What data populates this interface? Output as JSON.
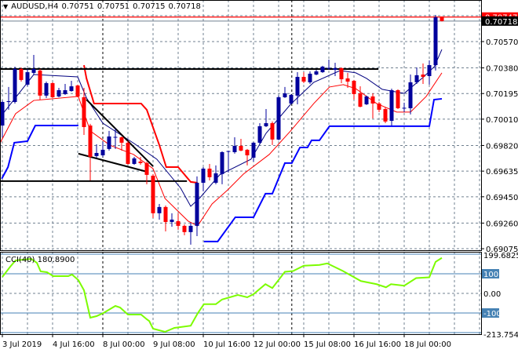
{
  "header": {
    "symbol": "AUDUSD,H4",
    "open": "0.70751",
    "high": "0.70751",
    "low": "0.70715",
    "close": "0.70718",
    "menu_icon": "triangle-down-icon"
  },
  "colors": {
    "bull": "#00009c",
    "bear": "#ff0000",
    "ma_fast": "#000080",
    "ma_slow": "#ff0000",
    "channel_upper": "#ff0000",
    "channel_lower": "#0000ff",
    "cci": "#7cfc00",
    "grid": "#708090",
    "level": "#4682b4"
  },
  "price_labels": {
    "bid": "0.70718",
    "marker": "0.70747"
  },
  "cci": {
    "title": "CCI(40) 180.8900",
    "axis_labels": [
      "199.6825",
      "100",
      "0.00",
      "-100",
      "-213.7544"
    ]
  },
  "chart_data": [
    {
      "type": "candlestick",
      "title": "AUDUSD,H4",
      "ylim": [
        0.69064,
        0.7087
      ],
      "y_ticks": [
        "0.70570",
        "0.70380",
        "0.70195",
        "0.70010",
        "0.69820",
        "0.69635",
        "0.69450",
        "0.69260",
        "0.69075"
      ],
      "y_tick_values": [
        0.7057,
        0.7038,
        0.70195,
        0.7001,
        0.6982,
        0.69635,
        0.6945,
        0.6926,
        0.69075
      ],
      "x_labels": [
        {
          "bar": 1,
          "text": "3 Jul 2019"
        },
        {
          "bar": 9,
          "text": "4 Jul 16:00"
        },
        {
          "bar": 17,
          "text": "8 Jul 00:00"
        },
        {
          "bar": 25,
          "text": "9 Jul 08:00"
        },
        {
          "bar": 33,
          "text": "10 Jul 16:00"
        },
        {
          "bar": 41,
          "text": "12 Jul 00:00"
        },
        {
          "bar": 49,
          "text": "15 Jul 08:00"
        },
        {
          "bar": 57,
          "text": "16 Jul 16:00"
        },
        {
          "bar": 65,
          "text": "18 Jul 00:00"
        }
      ],
      "ohlc": [
        [
          0.69964,
          0.70145,
          0.69879,
          0.70134
        ],
        [
          0.70134,
          0.70242,
          0.70078,
          0.7014
        ],
        [
          0.70134,
          0.70389,
          0.70123,
          0.70372
        ],
        [
          0.70372,
          0.70383,
          0.70281,
          0.70293
        ],
        [
          0.70259,
          0.70372,
          0.70247,
          0.70349
        ],
        [
          0.70344,
          0.70474,
          0.70332,
          0.70372
        ],
        [
          0.70361,
          0.70372,
          0.70151,
          0.7018
        ],
        [
          0.7018,
          0.70281,
          0.70163,
          0.7027
        ],
        [
          0.7027,
          0.70276,
          0.70163,
          0.70168
        ],
        [
          0.70174,
          0.70236,
          0.70168,
          0.70219
        ],
        [
          0.70191,
          0.70264,
          0.70185,
          0.70219
        ],
        [
          0.70213,
          0.70287,
          0.70208,
          0.70247
        ],
        [
          0.70253,
          0.70259,
          0.70168,
          0.70174
        ],
        [
          0.70168,
          0.70236,
          0.69896,
          0.69953
        ],
        [
          0.69964,
          0.69976,
          0.69568,
          0.69738
        ],
        [
          0.69744,
          0.69829,
          0.69732,
          0.69766
        ],
        [
          0.69749,
          0.69846,
          0.69738,
          0.69789
        ],
        [
          0.69795,
          0.69925,
          0.69783,
          0.69885
        ],
        [
          0.69879,
          0.69942,
          0.69795,
          0.69882
        ],
        [
          0.69879,
          0.69885,
          0.69783,
          0.6984
        ],
        [
          0.6984,
          0.69851,
          0.69681,
          0.69687
        ],
        [
          0.69687,
          0.69738,
          0.69681,
          0.69727
        ],
        [
          0.69704,
          0.69738,
          0.69681,
          0.69693
        ],
        [
          0.69693,
          0.69704,
          0.6954,
          0.69608
        ],
        [
          0.69602,
          0.69614,
          0.69296,
          0.69331
        ],
        [
          0.69331,
          0.69398,
          0.69285,
          0.69376
        ],
        [
          0.69376,
          0.69387,
          0.692,
          0.69268
        ],
        [
          0.69268,
          0.69331,
          0.69234,
          0.69285
        ],
        [
          0.69274,
          0.69331,
          0.69212,
          0.6924
        ],
        [
          0.6924,
          0.69251,
          0.69172,
          0.69195
        ],
        [
          0.69195,
          0.69263,
          0.69104,
          0.6924
        ],
        [
          0.6924,
          0.69597,
          0.69166,
          0.69551
        ],
        [
          0.69551,
          0.69664,
          0.69489,
          0.69653
        ],
        [
          0.69653,
          0.69687,
          0.69568,
          0.69591
        ],
        [
          0.69551,
          0.69676,
          0.6954,
          0.69619
        ],
        [
          0.69614,
          0.69778,
          0.6954,
          0.69772
        ],
        [
          0.69778,
          0.69782,
          0.69625,
          0.6978
        ],
        [
          0.69772,
          0.69879,
          0.69761,
          0.69817
        ],
        [
          0.69817,
          0.69868,
          0.69778,
          0.69783
        ],
        [
          0.69789,
          0.69795,
          0.69676,
          0.69749
        ],
        [
          0.69732,
          0.69846,
          0.69704,
          0.6984
        ],
        [
          0.6984,
          0.69981,
          0.69829,
          0.69959
        ],
        [
          0.69959,
          0.70083,
          0.69953,
          0.69981
        ],
        [
          0.69981,
          0.69993,
          0.69823,
          0.69863
        ],
        [
          0.69863,
          0.7018,
          0.69857,
          0.70168
        ],
        [
          0.70168,
          0.70242,
          0.70163,
          0.70196
        ],
        [
          0.70123,
          0.70191,
          0.70117,
          0.70185
        ],
        [
          0.7018,
          0.70349,
          0.70117,
          0.70315
        ],
        [
          0.70315,
          0.70349,
          0.7027,
          0.70281
        ],
        [
          0.70276,
          0.70355,
          0.70264,
          0.70338
        ],
        [
          0.70332,
          0.70366,
          0.70327,
          0.70355
        ],
        [
          0.70349,
          0.70395,
          0.70344,
          0.70389
        ],
        [
          0.70378,
          0.7044,
          0.70366,
          0.7038
        ],
        [
          0.70366,
          0.70417,
          0.70321,
          0.70378
        ],
        [
          0.70378,
          0.70383,
          0.7027,
          0.70298
        ],
        [
          0.70304,
          0.70344,
          0.70236,
          0.70281
        ],
        [
          0.70287,
          0.70293,
          0.70151,
          0.70191
        ],
        [
          0.70196,
          0.70247,
          0.70095,
          0.701
        ],
        [
          0.70117,
          0.7018,
          0.70112,
          0.70174
        ],
        [
          0.70174,
          0.70196,
          0.70015,
          0.70123
        ],
        [
          0.70123,
          0.70134,
          0.70061,
          0.70078
        ],
        [
          0.70083,
          0.70095,
          0.69981,
          0.69993
        ],
        [
          0.69998,
          0.7023,
          0.69964,
          0.70219
        ],
        [
          0.70219,
          0.70225,
          0.70083,
          0.70089
        ],
        [
          0.70089,
          0.70129,
          0.70061,
          0.70092
        ],
        [
          0.70089,
          0.70332,
          0.70044,
          0.70276
        ],
        [
          0.70276,
          0.70383,
          0.70264,
          0.70327
        ],
        [
          0.70332,
          0.70412,
          0.70264,
          0.70315
        ],
        [
          0.70321,
          0.70434,
          0.70259,
          0.704
        ],
        [
          0.704,
          0.70762,
          0.70361,
          0.70745
        ],
        [
          0.70751,
          0.70751,
          0.70715,
          0.70718
        ]
      ],
      "ma_fast": [
        [
          0.6,
          0.70021
        ],
        [
          6,
          0.70332
        ],
        [
          13,
          0.70315
        ],
        [
          14.4,
          0.70163
        ],
        [
          17,
          0.69981
        ],
        [
          22,
          0.69834
        ],
        [
          25.6,
          0.69721
        ],
        [
          29.4,
          0.69512
        ],
        [
          31,
          0.69381
        ],
        [
          32.5,
          0.69444
        ],
        [
          35.6,
          0.69608
        ],
        [
          40.6,
          0.69721
        ],
        [
          43,
          0.69908
        ],
        [
          46.9,
          0.70117
        ],
        [
          50.6,
          0.70276
        ],
        [
          54.8,
          0.70361
        ],
        [
          57.3,
          0.70344
        ],
        [
          59,
          0.70304
        ],
        [
          61.5,
          0.70225
        ],
        [
          65,
          0.70196
        ],
        [
          68.1,
          0.70315
        ],
        [
          69.8,
          0.70389
        ],
        [
          71,
          0.70513
        ]
      ],
      "ma_slow": [
        [
          0.6,
          0.69834
        ],
        [
          3.1,
          0.70049
        ],
        [
          6,
          0.70145
        ],
        [
          13.1,
          0.70174
        ],
        [
          15,
          0.69925
        ],
        [
          18.1,
          0.69823
        ],
        [
          21.9,
          0.69755
        ],
        [
          25,
          0.69653
        ],
        [
          26.9,
          0.69438
        ],
        [
          30.6,
          0.69274
        ],
        [
          32.1,
          0.6924
        ],
        [
          34.4,
          0.69398
        ],
        [
          36.9,
          0.695
        ],
        [
          39.4,
          0.69614
        ],
        [
          43.5,
          0.69755
        ],
        [
          46.9,
          0.69925
        ],
        [
          50.6,
          0.70123
        ],
        [
          53.1,
          0.70242
        ],
        [
          55.3,
          0.70259
        ],
        [
          57.3,
          0.7023
        ],
        [
          60.6,
          0.70123
        ],
        [
          63.8,
          0.70061
        ],
        [
          66,
          0.70061
        ],
        [
          68.5,
          0.70174
        ],
        [
          71,
          0.70344
        ]
      ],
      "channel_upper": [
        [
          14,
          0.704
        ],
        [
          14.4,
          0.70304
        ],
        [
          15.6,
          0.70123
        ],
        [
          23.1,
          0.70123
        ],
        [
          24,
          0.70078
        ],
        [
          26,
          0.69823
        ],
        [
          27.1,
          0.69664
        ],
        [
          29,
          0.69664
        ],
        [
          31,
          0.69557
        ],
        [
          32.1,
          0.69551
        ]
      ],
      "channel_lower": [
        [
          [
            0.9,
            0.6958
          ],
          [
            1.9,
            0.69664
          ],
          [
            2.9,
            0.6984
          ],
          [
            5,
            0.69851
          ],
          [
            6.25,
            0.69964
          ],
          [
            13.1,
            0.69964
          ]
        ],
        [
          [
            33.1,
            0.69127
          ],
          [
            35.3,
            0.69127
          ],
          [
            38.1,
            0.69302
          ],
          [
            41,
            0.69302
          ],
          [
            42.9,
            0.69472
          ],
          [
            44,
            0.69472
          ],
          [
            46,
            0.69693
          ],
          [
            47.1,
            0.69693
          ],
          [
            48.4,
            0.69806
          ],
          [
            49.6,
            0.69806
          ],
          [
            50.25,
            0.69857
          ],
          [
            51.5,
            0.69857
          ],
          [
            53.1,
            0.69959
          ],
          [
            69,
            0.69959
          ],
          [
            69.75,
            0.70151
          ],
          [
            71,
            0.70157
          ]
        ]
      ],
      "trendlines": [
        {
          "name": "resistance-line",
          "from": [
            0.6,
            0.70372
          ],
          "to": [
            60.9,
            0.70372
          ]
        },
        {
          "name": "support-line",
          "from": [
            0.6,
            0.69563
          ],
          "to": [
            30.4,
            0.69563
          ]
        },
        {
          "name": "wedge-upper-line",
          "from": [
            14.4,
            0.70151
          ],
          "to": [
            25,
            0.6967
          ]
        },
        {
          "name": "wedge-lower-line",
          "from": [
            13.1,
            0.69761
          ],
          "to": [
            24,
            0.69631
          ]
        }
      ],
      "vertical_lines": [
        17,
        47.1
      ],
      "horizontal_levels": {
        "marker": 0.70747,
        "bid": 0.70718
      }
    },
    {
      "type": "line",
      "title": "CCI(40) 180.8900",
      "ylim": [
        -208,
        212
      ],
      "levels": [
        100,
        0,
        -100,
        -200,
        200
      ],
      "points": [
        [
          1,
          84
        ],
        [
          2.25,
          136
        ],
        [
          3.1,
          168
        ],
        [
          5.6,
          176
        ],
        [
          6.5,
          156
        ],
        [
          7.1,
          112
        ],
        [
          8.1,
          108
        ],
        [
          9.1,
          88
        ],
        [
          11.5,
          88
        ],
        [
          12.1,
          96
        ],
        [
          13.1,
          68
        ],
        [
          14,
          16
        ],
        [
          15,
          -124
        ],
        [
          16,
          -116
        ],
        [
          17.1,
          -100
        ],
        [
          19,
          -64
        ],
        [
          19.75,
          -72
        ],
        [
          21,
          -108
        ],
        [
          23.1,
          -108
        ],
        [
          24,
          -132
        ],
        [
          24.4,
          -141
        ],
        [
          25,
          -180
        ],
        [
          26.9,
          -196
        ],
        [
          28.4,
          -176
        ],
        [
          31,
          -165
        ],
        [
          32.1,
          -102
        ],
        [
          33.1,
          -55
        ],
        [
          35,
          -55
        ],
        [
          36,
          -31
        ],
        [
          38.5,
          -8
        ],
        [
          40,
          -20
        ],
        [
          41,
          -4
        ],
        [
          42.9,
          47
        ],
        [
          44,
          27
        ],
        [
          46,
          110
        ],
        [
          47.3,
          114
        ],
        [
          49,
          141
        ],
        [
          51.5,
          145
        ],
        [
          52.75,
          153
        ],
        [
          55.25,
          114
        ],
        [
          58.1,
          63
        ],
        [
          60.6,
          47
        ],
        [
          62.1,
          31
        ],
        [
          62.9,
          47
        ],
        [
          65,
          39
        ],
        [
          66.9,
          78
        ],
        [
          69,
          82
        ],
        [
          70,
          161
        ],
        [
          71,
          181
        ]
      ]
    }
  ]
}
